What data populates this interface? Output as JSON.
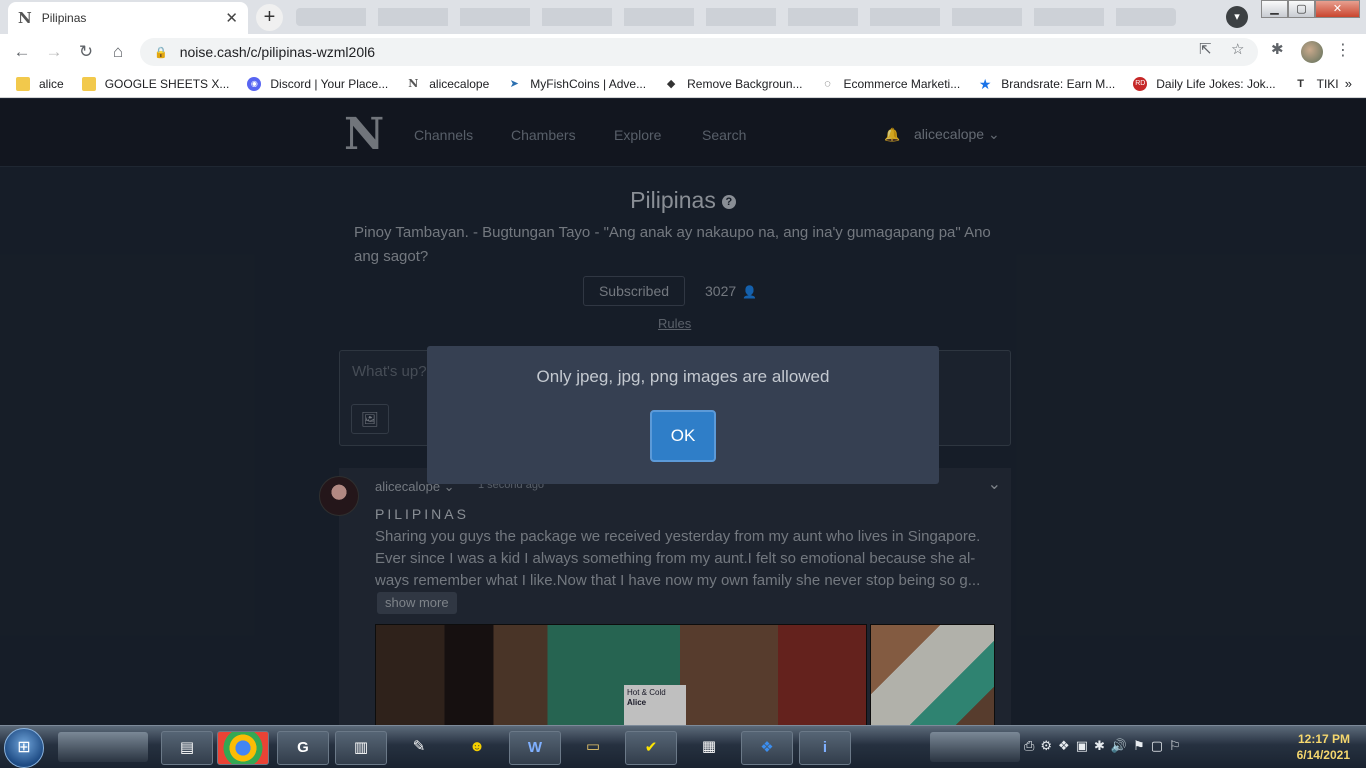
{
  "browser": {
    "tab_title": "Pilipinas",
    "url": "noise.cash/c/pilipinas-wzml20l6",
    "bookmarks": [
      {
        "label": "alice",
        "icon": "folder-icon"
      },
      {
        "label": "GOOGLE SHEETS X...",
        "icon": "folder-icon"
      },
      {
        "label": "Discord | Your Place...",
        "icon": "discord-icon"
      },
      {
        "label": "alicecalope",
        "icon": "noise-icon"
      },
      {
        "label": "MyFishCoins | Adve...",
        "icon": "fish-icon"
      },
      {
        "label": "Remove Backgroun...",
        "icon": "layers-icon"
      },
      {
        "label": "Ecommerce Marketi...",
        "icon": "ecom-icon"
      },
      {
        "label": "Brandsrate: Earn M...",
        "icon": "star-icon"
      },
      {
        "label": "Daily Life Jokes: Jok...",
        "icon": "rd-icon"
      },
      {
        "label": "TIKI",
        "icon": "tiki-icon"
      }
    ]
  },
  "site_nav": {
    "links": [
      "Channels",
      "Chambers",
      "Explore",
      "Search"
    ],
    "username": "alicecalope"
  },
  "channel": {
    "title": "Pilipinas",
    "description": "Pinoy Tambayan. - Bugtungan Tayo - \"Ang anak ay nakaupo na, ang ina'y gumagapang pa\" Ano ang sagot?",
    "subscribe_label": "Subscribed",
    "subscriber_count": "3027",
    "rules_label": "Rules"
  },
  "composer": {
    "placeholder": "What's up?"
  },
  "post": {
    "author": "alicecalope",
    "time": "1 second ago",
    "channel": "PILIPINAS",
    "body": "Sharing you guys the package we received yesterday from my aunt who lives in Singapore. Ever since I was a kid I always something from my aunt.I felt so emotional because she al-ways remember what I like.Now that I have now my own family she never stop being so g...",
    "show_more": "show more",
    "photo_label_line1": "Hot & Cold",
    "photo_label_line2": "Alice"
  },
  "dialog": {
    "message": "Only jpeg, jpg, png images are allowed",
    "ok_label": "OK"
  },
  "taskbar": {
    "time": "12:17 PM",
    "date": "6/14/2021"
  }
}
